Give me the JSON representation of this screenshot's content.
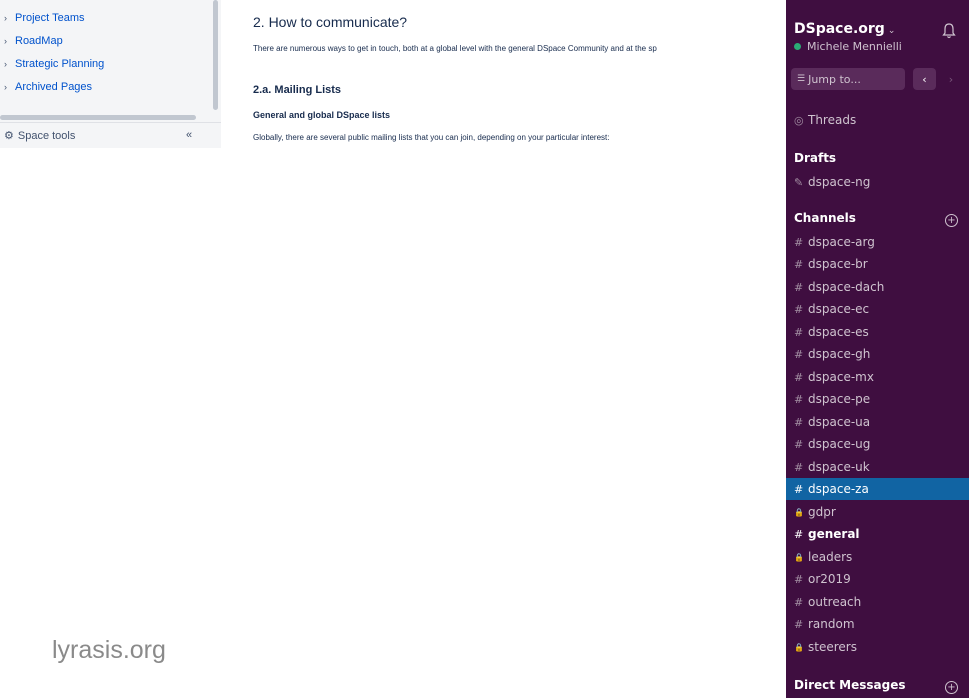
{
  "confluence": {
    "tree": [
      {
        "label": "Project Teams"
      },
      {
        "label": "RoadMap"
      },
      {
        "label": "Strategic Planning"
      },
      {
        "label": "Archived Pages"
      }
    ],
    "space_tools": "Space tools",
    "collapse_label": "«"
  },
  "content": {
    "heading": "2. How to communicate?",
    "intro": "There are numerous ways to get in touch, both at a global level with the general DSpace Community and at the sp",
    "subheading": "2.a. Mailing Lists",
    "subsubheading": "General and global DSpace lists",
    "paragraph": "Globally, there are several public mailing lists that you can join, depending on your particular interest:"
  },
  "watermark": "lyrasis.org",
  "slack": {
    "workspace": "DSpace.org",
    "workspace_caret": "⌄",
    "user": "Michele Mennielli",
    "status_color": "#2bac76",
    "jump_placeholder": "Jump to...",
    "back_label": "‹",
    "forward_label": "›",
    "threads": "Threads",
    "drafts_header": "Drafts",
    "drafts": [
      {
        "name": "dspace-ng"
      }
    ],
    "channels_header": "Channels",
    "channels": [
      {
        "prefix": "#",
        "name": "dspace-arg"
      },
      {
        "prefix": "#",
        "name": "dspace-br"
      },
      {
        "prefix": "#",
        "name": "dspace-dach"
      },
      {
        "prefix": "#",
        "name": "dspace-ec"
      },
      {
        "prefix": "#",
        "name": "dspace-es"
      },
      {
        "prefix": "#",
        "name": "dspace-gh"
      },
      {
        "prefix": "#",
        "name": "dspace-mx"
      },
      {
        "prefix": "#",
        "name": "dspace-pe"
      },
      {
        "prefix": "#",
        "name": "dspace-ua"
      },
      {
        "prefix": "#",
        "name": "dspace-ug"
      },
      {
        "prefix": "#",
        "name": "dspace-uk"
      },
      {
        "prefix": "#",
        "name": "dspace-za"
      },
      {
        "prefix": "🔒",
        "name": "gdpr"
      },
      {
        "prefix": "#",
        "name": "general"
      },
      {
        "prefix": "🔒",
        "name": "leaders"
      },
      {
        "prefix": "#",
        "name": "or2019"
      },
      {
        "prefix": "#",
        "name": "outreach"
      },
      {
        "prefix": "#",
        "name": "random"
      },
      {
        "prefix": "🔒",
        "name": "steerers"
      }
    ],
    "dm_header": "Direct Messages",
    "accent": "#1164a3",
    "background": "#3f0e40"
  }
}
